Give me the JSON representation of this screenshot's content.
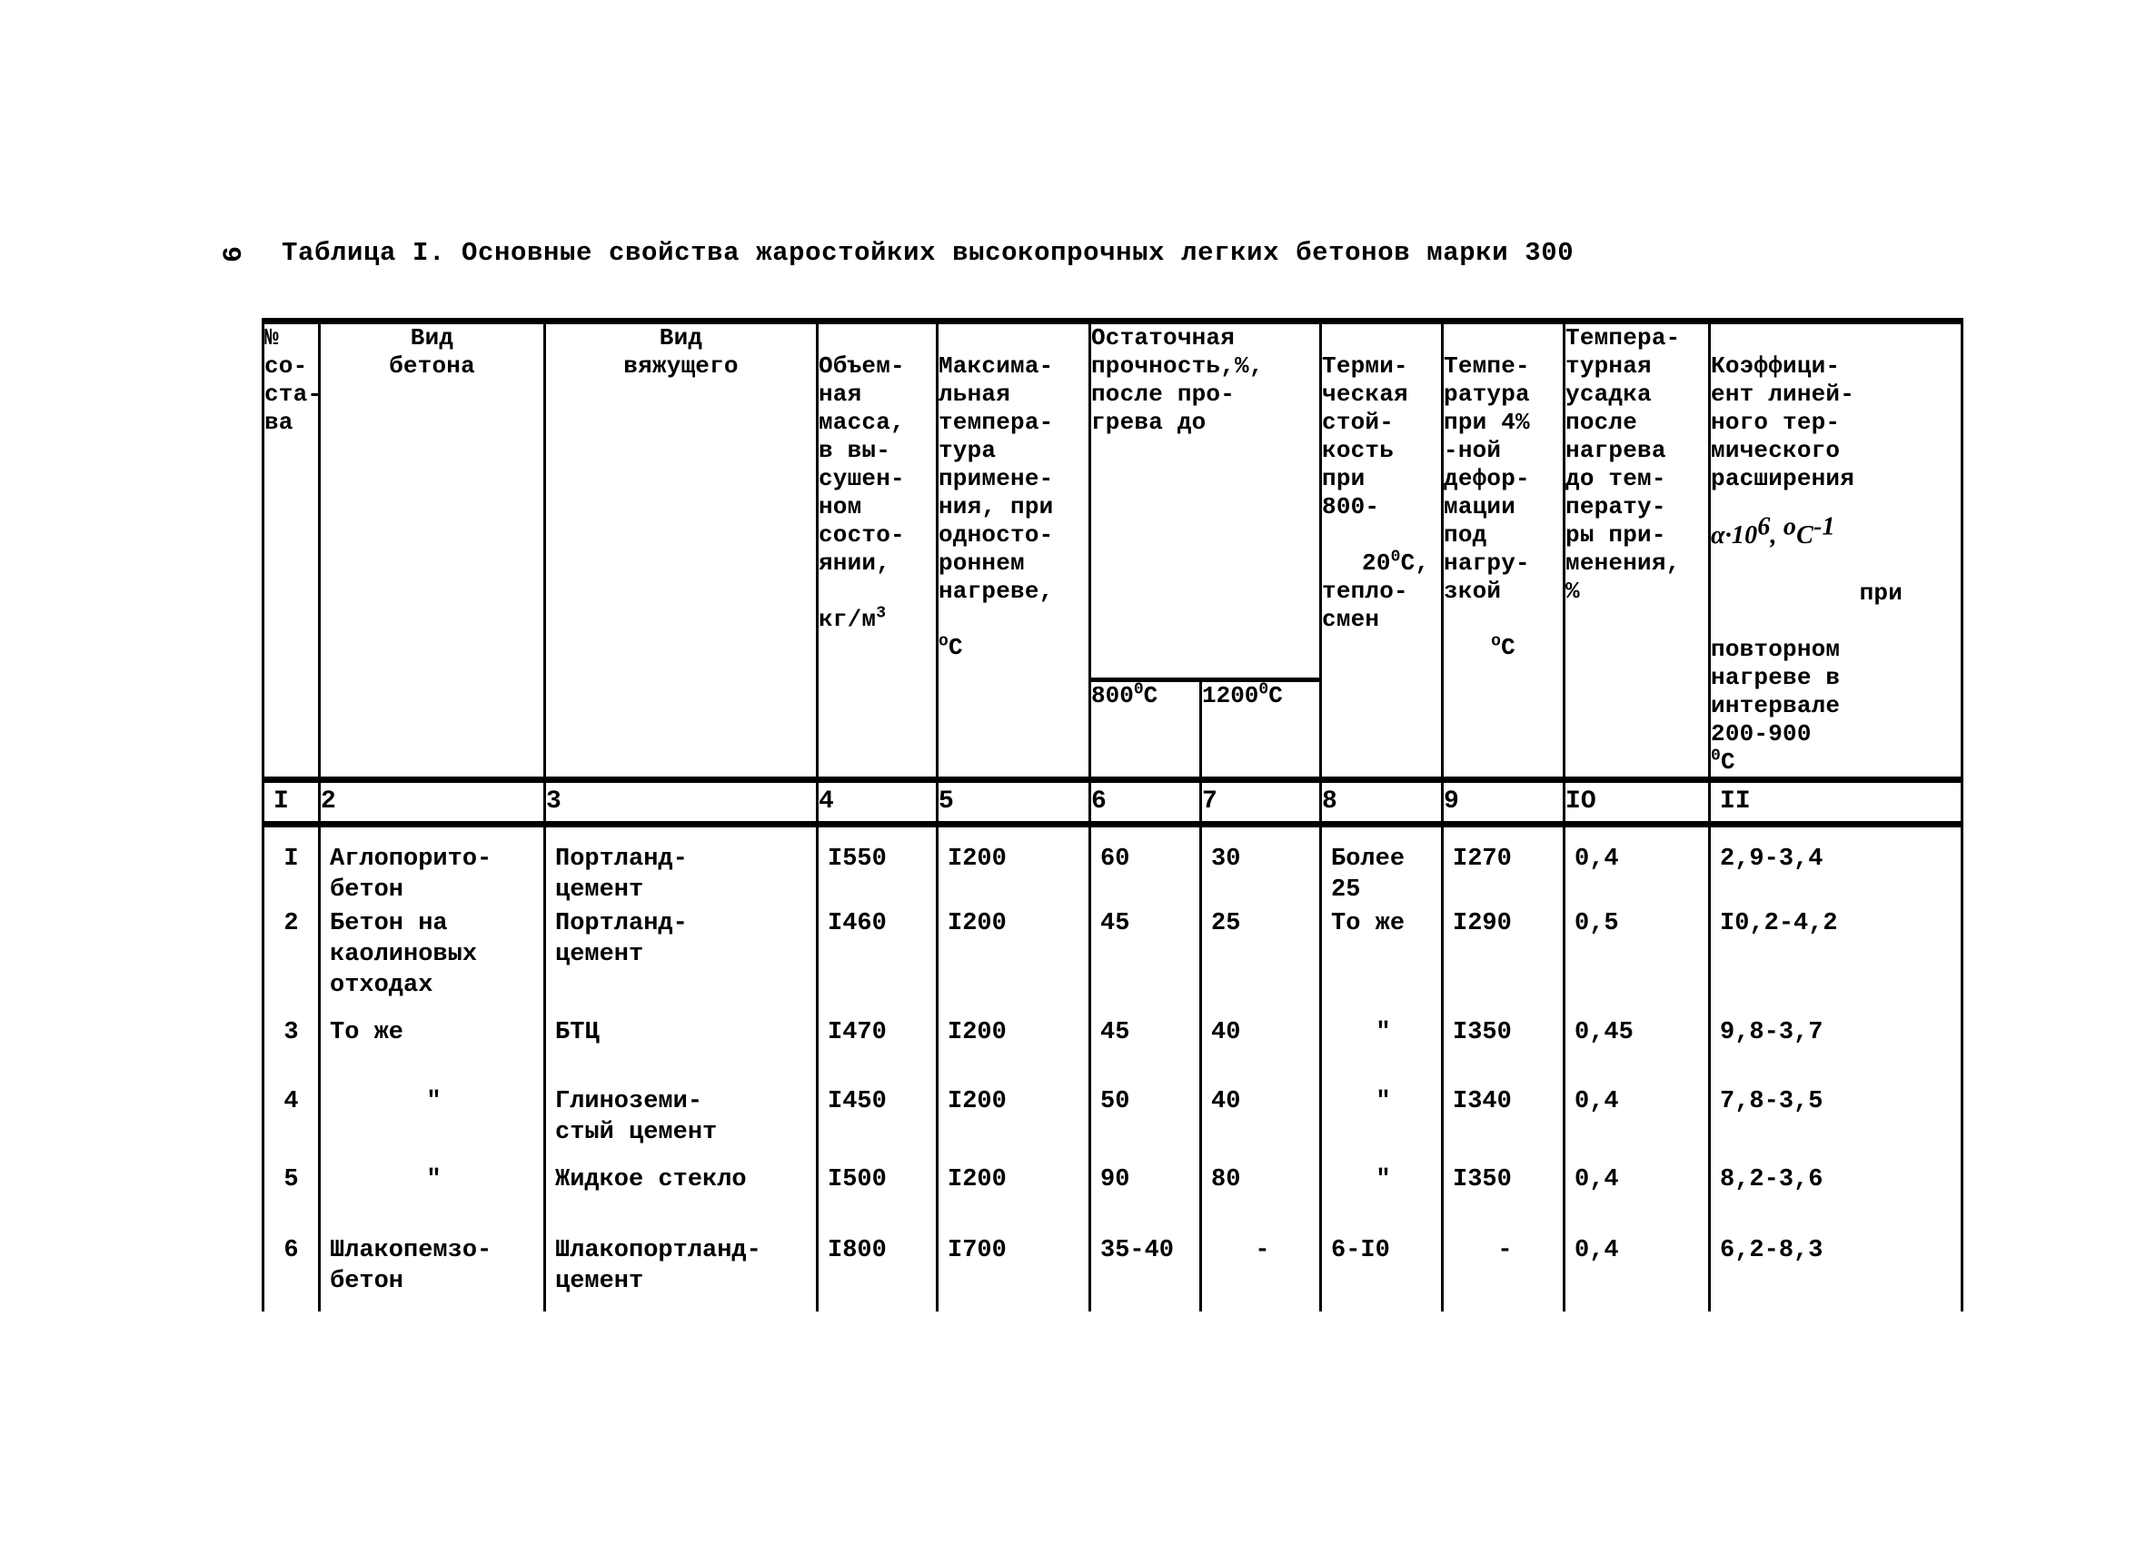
{
  "page": {
    "folio": "6"
  },
  "caption": "Таблица I. Основные свойства жаростойких высокопрочных легких бетонов марки 300",
  "table": {
    "headers": {
      "col1": "№\nсо-\nста-\nва",
      "col2": "Вид\nбетона",
      "col3": "Вид\nвяжущего",
      "col4": "Объем-\nная\nмасса,\nв вы-\nсушен-\nном\nсосто-\nянии,",
      "col4_units": "кг/м",
      "col4_units_sup": "3",
      "col5": "Максима-\nльная\nтемпера-\nтура\nпримене-\nния, при\nодносто-\nроннем\nнагреве,",
      "col5_units": "o",
      "col5_units2": "С",
      "col6_7_group": "Остаточная\nпрочность,%,\nпосле про-\nгрева до",
      "col6": "800",
      "col6_sup": "0",
      "col6_tail": "С",
      "col7": "1200",
      "col7_sup": "0",
      "col7_tail": "С",
      "col8": "Терми-\nческая\nстой-\nкость\nпри\n800-",
      "col8_l2": "20",
      "col8_l2_sup": "0",
      "col8_l2_tail": "С,",
      "col8_tail": "тепло-\nсмен",
      "col9": "Темпе-\nратура\nпри 4%\n-ной\nдефор-\nмации\nпод\nнагру-\nзкой",
      "col9_units_sup": "o",
      "col9_units": "С",
      "col10": "Темпера-\nтурная\nусадка\nпосле\nнагрева\nдо тем-\nперату-\nры при-\nменения,\n%",
      "col11_a": "Коэффици-\nент линей-\nного тер-\nмического\nрасширения",
      "col11_formula": "α·10",
      "col11_formula_sup": "6",
      "col11_formula_mid": ", ",
      "col11_formula_deg": "о",
      "col11_formula_c": "С",
      "col11_formula_exp": "-1",
      "col11_b": "при",
      "col11_c": "повторном\nнагреве в\nинтервале\n200-900",
      "col11_c_sup": "0",
      "col11_c_tail": "С"
    },
    "number_row": [
      "I",
      "2",
      "3",
      "4",
      "5",
      "6",
      "7",
      "8",
      "9",
      "IO",
      "II"
    ],
    "rows": [
      {
        "no": "I",
        "concrete": "Аглопорито-\nбетон",
        "binder": "Портланд-\nцемент",
        "density": "I550",
        "maxtemp": "I200",
        "res800": "60",
        "res1200": "30",
        "thermal": "Более\n25",
        "deform_temp": "I270",
        "shrinkage": "0,4",
        "expansion": "2,9-3,4"
      },
      {
        "no": "2",
        "concrete": "Бетон на\nкаолиновых\nотходах",
        "binder": "Портланд-\nцемент",
        "density": "I460",
        "maxtemp": "I200",
        "res800": "45",
        "res1200": "25",
        "thermal": "То же",
        "deform_temp": "I290",
        "shrinkage": "0,5",
        "expansion": "I0,2-4,2"
      },
      {
        "no": "3",
        "concrete": "То же",
        "binder": "БТЦ",
        "density": "I470",
        "maxtemp": "I200",
        "res800": "45",
        "res1200": "40",
        "thermal": "\"",
        "deform_temp": "I350",
        "shrinkage": "0,45",
        "expansion": "9,8-3,7"
      },
      {
        "no": "4",
        "concrete": "\"",
        "binder": "Глиноземи-\nстый цемент",
        "density": "I450",
        "maxtemp": "I200",
        "res800": "50",
        "res1200": "40",
        "thermal": "\"",
        "deform_temp": "I340",
        "shrinkage": "0,4",
        "expansion": "7,8-3,5"
      },
      {
        "no": "5",
        "concrete": "\"",
        "binder": "Жидкое стекло",
        "density": "I500",
        "maxtemp": "I200",
        "res800": "90",
        "res1200": "80",
        "thermal": "\"",
        "deform_temp": "I350",
        "shrinkage": "0,4",
        "expansion": "8,2-3,6"
      },
      {
        "no": "6",
        "concrete": "Шлакопемзо-\nбетон",
        "binder": "Шлакопортланд-\nцемент",
        "density": "I800",
        "maxtemp": "I700",
        "res800": "35-40",
        "res1200": "-",
        "thermal": "6-I0",
        "deform_temp": "-",
        "shrinkage": "0,4",
        "expansion": "6,2-8,3"
      }
    ]
  }
}
